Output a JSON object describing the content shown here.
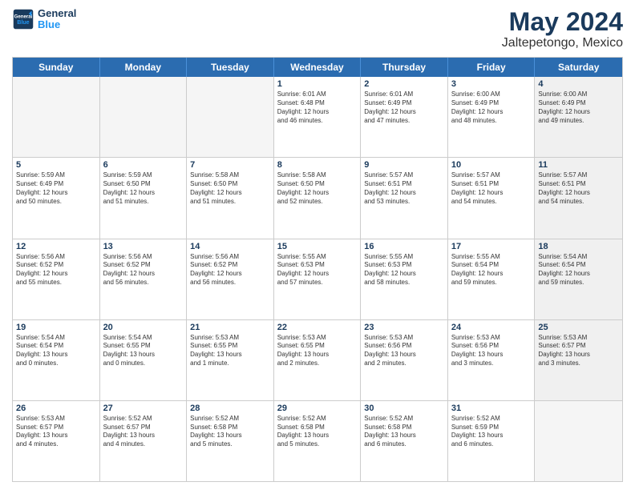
{
  "header": {
    "logo_line1": "General",
    "logo_line2": "Blue",
    "title": "May 2024",
    "subtitle": "Jaltepetongo, Mexico"
  },
  "weekdays": [
    "Sunday",
    "Monday",
    "Tuesday",
    "Wednesday",
    "Thursday",
    "Friday",
    "Saturday"
  ],
  "rows": [
    [
      {
        "day": "",
        "info": "",
        "empty": true
      },
      {
        "day": "",
        "info": "",
        "empty": true
      },
      {
        "day": "",
        "info": "",
        "empty": true
      },
      {
        "day": "1",
        "info": "Sunrise: 6:01 AM\nSunset: 6:48 PM\nDaylight: 12 hours\nand 46 minutes."
      },
      {
        "day": "2",
        "info": "Sunrise: 6:01 AM\nSunset: 6:49 PM\nDaylight: 12 hours\nand 47 minutes."
      },
      {
        "day": "3",
        "info": "Sunrise: 6:00 AM\nSunset: 6:49 PM\nDaylight: 12 hours\nand 48 minutes."
      },
      {
        "day": "4",
        "info": "Sunrise: 6:00 AM\nSunset: 6:49 PM\nDaylight: 12 hours\nand 49 minutes.",
        "shaded": true
      }
    ],
    [
      {
        "day": "5",
        "info": "Sunrise: 5:59 AM\nSunset: 6:49 PM\nDaylight: 12 hours\nand 50 minutes."
      },
      {
        "day": "6",
        "info": "Sunrise: 5:59 AM\nSunset: 6:50 PM\nDaylight: 12 hours\nand 51 minutes."
      },
      {
        "day": "7",
        "info": "Sunrise: 5:58 AM\nSunset: 6:50 PM\nDaylight: 12 hours\nand 51 minutes."
      },
      {
        "day": "8",
        "info": "Sunrise: 5:58 AM\nSunset: 6:50 PM\nDaylight: 12 hours\nand 52 minutes."
      },
      {
        "day": "9",
        "info": "Sunrise: 5:57 AM\nSunset: 6:51 PM\nDaylight: 12 hours\nand 53 minutes."
      },
      {
        "day": "10",
        "info": "Sunrise: 5:57 AM\nSunset: 6:51 PM\nDaylight: 12 hours\nand 54 minutes."
      },
      {
        "day": "11",
        "info": "Sunrise: 5:57 AM\nSunset: 6:51 PM\nDaylight: 12 hours\nand 54 minutes.",
        "shaded": true
      }
    ],
    [
      {
        "day": "12",
        "info": "Sunrise: 5:56 AM\nSunset: 6:52 PM\nDaylight: 12 hours\nand 55 minutes."
      },
      {
        "day": "13",
        "info": "Sunrise: 5:56 AM\nSunset: 6:52 PM\nDaylight: 12 hours\nand 56 minutes."
      },
      {
        "day": "14",
        "info": "Sunrise: 5:56 AM\nSunset: 6:52 PM\nDaylight: 12 hours\nand 56 minutes."
      },
      {
        "day": "15",
        "info": "Sunrise: 5:55 AM\nSunset: 6:53 PM\nDaylight: 12 hours\nand 57 minutes."
      },
      {
        "day": "16",
        "info": "Sunrise: 5:55 AM\nSunset: 6:53 PM\nDaylight: 12 hours\nand 58 minutes."
      },
      {
        "day": "17",
        "info": "Sunrise: 5:55 AM\nSunset: 6:54 PM\nDaylight: 12 hours\nand 59 minutes."
      },
      {
        "day": "18",
        "info": "Sunrise: 5:54 AM\nSunset: 6:54 PM\nDaylight: 12 hours\nand 59 minutes.",
        "shaded": true
      }
    ],
    [
      {
        "day": "19",
        "info": "Sunrise: 5:54 AM\nSunset: 6:54 PM\nDaylight: 13 hours\nand 0 minutes."
      },
      {
        "day": "20",
        "info": "Sunrise: 5:54 AM\nSunset: 6:55 PM\nDaylight: 13 hours\nand 0 minutes."
      },
      {
        "day": "21",
        "info": "Sunrise: 5:53 AM\nSunset: 6:55 PM\nDaylight: 13 hours\nand 1 minute."
      },
      {
        "day": "22",
        "info": "Sunrise: 5:53 AM\nSunset: 6:55 PM\nDaylight: 13 hours\nand 2 minutes."
      },
      {
        "day": "23",
        "info": "Sunrise: 5:53 AM\nSunset: 6:56 PM\nDaylight: 13 hours\nand 2 minutes."
      },
      {
        "day": "24",
        "info": "Sunrise: 5:53 AM\nSunset: 6:56 PM\nDaylight: 13 hours\nand 3 minutes."
      },
      {
        "day": "25",
        "info": "Sunrise: 5:53 AM\nSunset: 6:57 PM\nDaylight: 13 hours\nand 3 minutes.",
        "shaded": true
      }
    ],
    [
      {
        "day": "26",
        "info": "Sunrise: 5:53 AM\nSunset: 6:57 PM\nDaylight: 13 hours\nand 4 minutes."
      },
      {
        "day": "27",
        "info": "Sunrise: 5:52 AM\nSunset: 6:57 PM\nDaylight: 13 hours\nand 4 minutes."
      },
      {
        "day": "28",
        "info": "Sunrise: 5:52 AM\nSunset: 6:58 PM\nDaylight: 13 hours\nand 5 minutes."
      },
      {
        "day": "29",
        "info": "Sunrise: 5:52 AM\nSunset: 6:58 PM\nDaylight: 13 hours\nand 5 minutes."
      },
      {
        "day": "30",
        "info": "Sunrise: 5:52 AM\nSunset: 6:58 PM\nDaylight: 13 hours\nand 6 minutes."
      },
      {
        "day": "31",
        "info": "Sunrise: 5:52 AM\nSunset: 6:59 PM\nDaylight: 13 hours\nand 6 minutes."
      },
      {
        "day": "",
        "info": "",
        "empty": true
      }
    ]
  ]
}
